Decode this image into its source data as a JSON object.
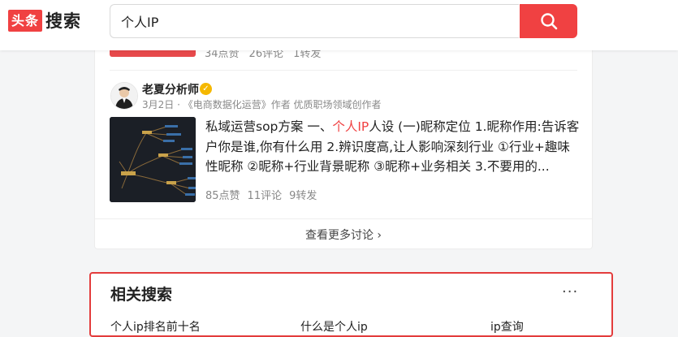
{
  "header": {
    "logo_box": "头条",
    "logo_text": "搜索",
    "search_value": "个人IP"
  },
  "previous_post": {
    "stats": [
      "34点赞",
      "26评论",
      "1转发"
    ]
  },
  "post": {
    "author_name": "老夏分析师",
    "author_meta": "3月2日 · 《电商数据化运营》作者 优质职场领域创作者",
    "text_before": "私域运营sop方案 一、",
    "text_highlight": "个人IP",
    "text_after": "人设 (一)昵称定位 1.昵称作用:告诉客户你是谁,你有什么用 2.辨识度高,让人影响深刻行业 ①行业+趣味性昵称 ②昵称+行业背景昵称 ③昵称+业务相关 3.不要用的...",
    "likes": "85点赞",
    "comments": "11评论",
    "shares": "9转发"
  },
  "more_discussion": "查看更多讨论 ›",
  "related": {
    "title": "相关搜索",
    "more": "···",
    "items": [
      "个人ip排名前十名",
      "什么是个人ip",
      "ip查询"
    ]
  },
  "colors": {
    "brand_red": "#f04142",
    "verify_gold": "#f5b800"
  }
}
